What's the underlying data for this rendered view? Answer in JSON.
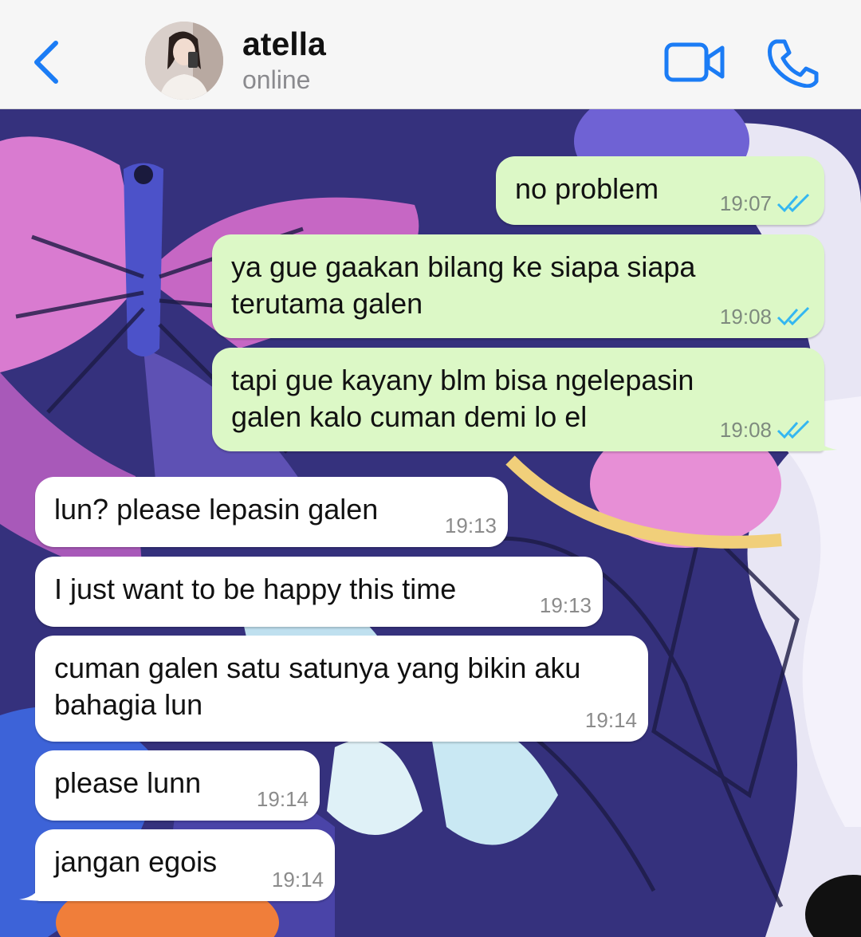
{
  "header": {
    "contact_name": "atella",
    "status": "online",
    "accent": "#1b7cf5"
  },
  "messages": [
    {
      "direction": "outgoing",
      "text": "no problem",
      "time": "19:07",
      "read": true
    },
    {
      "direction": "outgoing",
      "text": "ya gue gaakan bilang ke siapa siapa\nterutama galen",
      "time": "19:08",
      "read": true
    },
    {
      "direction": "outgoing",
      "text": "tapi gue kayany blm bisa ngelepasin\ngalen kalo cuman demi lo el",
      "time": "19:08",
      "read": true
    },
    {
      "direction": "incoming",
      "text": "lun? please lepasin galen",
      "time": "19:13"
    },
    {
      "direction": "incoming",
      "text": "I just want to be happy this time",
      "time": "19:13"
    },
    {
      "direction": "incoming",
      "text": "cuman galen satu satunya yang bikin aku\nbahagia lun",
      "time": "19:14"
    },
    {
      "direction": "incoming",
      "text": "please lunn",
      "time": "19:14"
    },
    {
      "direction": "incoming",
      "text": "jangan egois",
      "time": "19:14"
    }
  ],
  "colors": {
    "outgoing_bubble": "#dcf8c6",
    "incoming_bubble": "#ffffff",
    "read_ticks": "#34b7f1"
  }
}
